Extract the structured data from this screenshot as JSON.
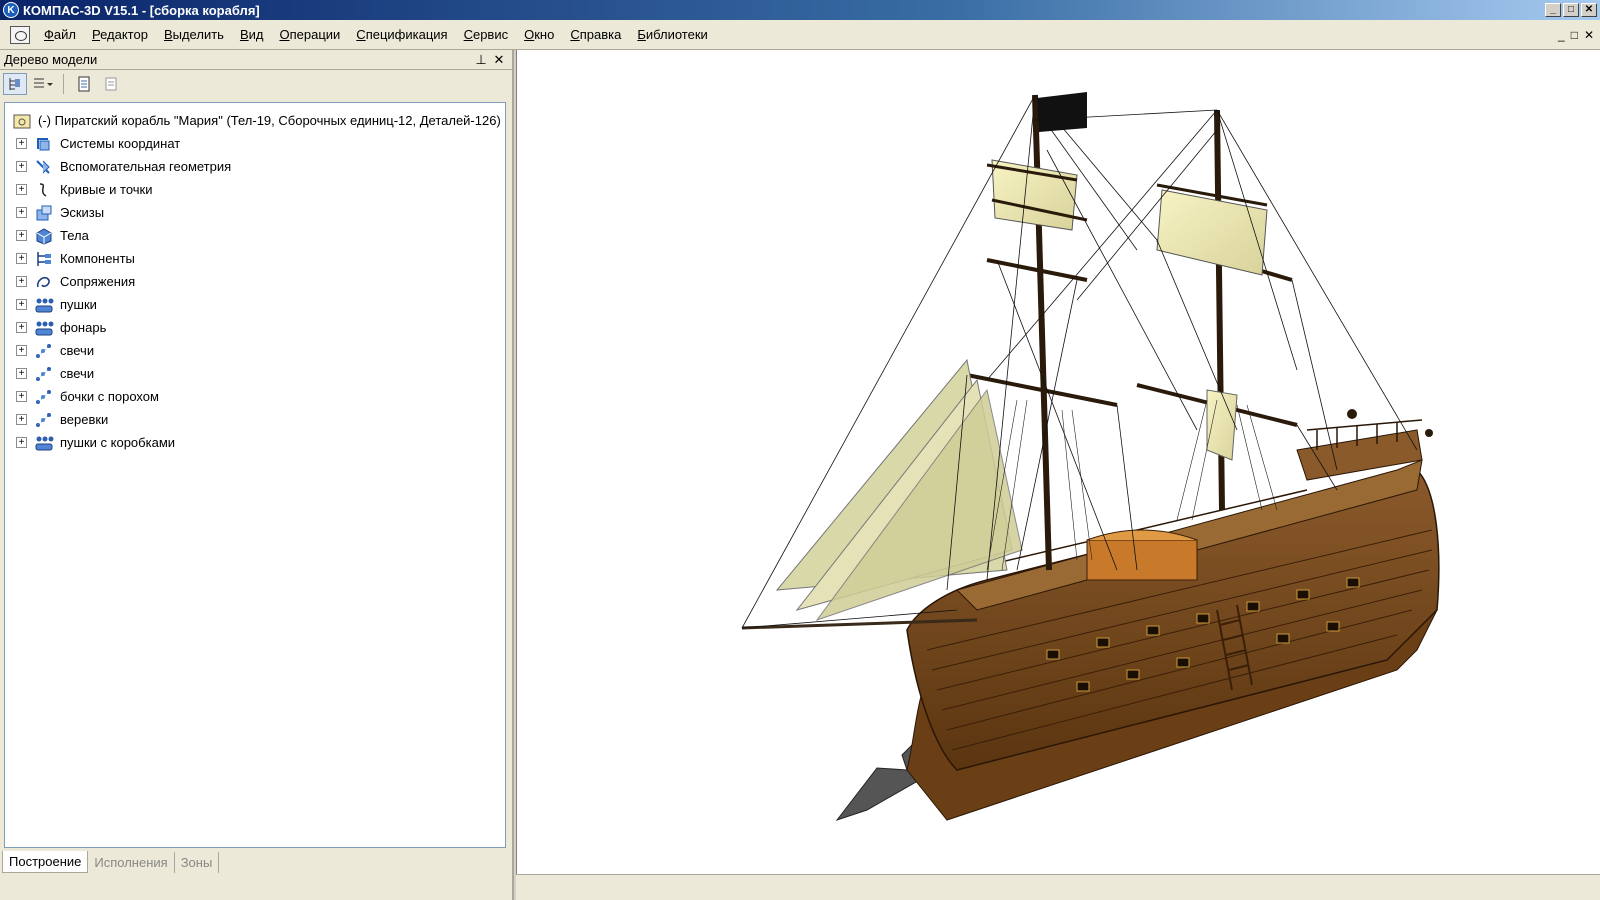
{
  "window": {
    "title": "КОМПАС-3D V15.1 - [сборка корабля]",
    "app_icon": "K",
    "buttons": [
      "_",
      "□",
      "✕"
    ]
  },
  "menu": {
    "items": [
      "Файл",
      "Редактор",
      "Выделить",
      "Вид",
      "Операции",
      "Спецификация",
      "Сервис",
      "Окно",
      "Справка",
      "Библиотеки"
    ],
    "mdi_buttons": [
      "_",
      "□",
      "✕"
    ]
  },
  "panel": {
    "title": "Дерево модели",
    "pin": "📌",
    "close": "✕"
  },
  "tree": {
    "root": "(-) Пиратский корабль \"Мария\" (Тел-19, Сборочных единиц-12, Деталей-126)",
    "items": [
      {
        "label": "Системы координат",
        "icon": "coordinate-systems-icon"
      },
      {
        "label": "Вспомогательная геометрия",
        "icon": "auxiliary-geometry-icon"
      },
      {
        "label": "Кривые и точки",
        "icon": "curves-points-icon"
      },
      {
        "label": "Эскизы",
        "icon": "sketches-icon"
      },
      {
        "label": "Тела",
        "icon": "bodies-icon"
      },
      {
        "label": "Компоненты",
        "icon": "components-icon"
      },
      {
        "label": "Сопряжения",
        "icon": "mates-icon"
      },
      {
        "label": "пушки",
        "icon": "assembly-group-icon"
      },
      {
        "label": "фонарь",
        "icon": "assembly-group-icon"
      },
      {
        "label": "свечи",
        "icon": "part-group-icon"
      },
      {
        "label": "свечи",
        "icon": "part-group-icon"
      },
      {
        "label": "бочки с порохом",
        "icon": "part-group-icon"
      },
      {
        "label": "веревки",
        "icon": "part-group-icon"
      },
      {
        "label": "пушки с коробками",
        "icon": "assembly-group-icon"
      }
    ]
  },
  "panel_tabs": [
    "Построение",
    "Исполнения",
    "Зоны"
  ],
  "colors": {
    "title_start": "#0a246a",
    "hull": "#7a4a1e",
    "sail": "#f0ecb0",
    "sail_green": "#d9d8a8",
    "flag": "#111111"
  }
}
